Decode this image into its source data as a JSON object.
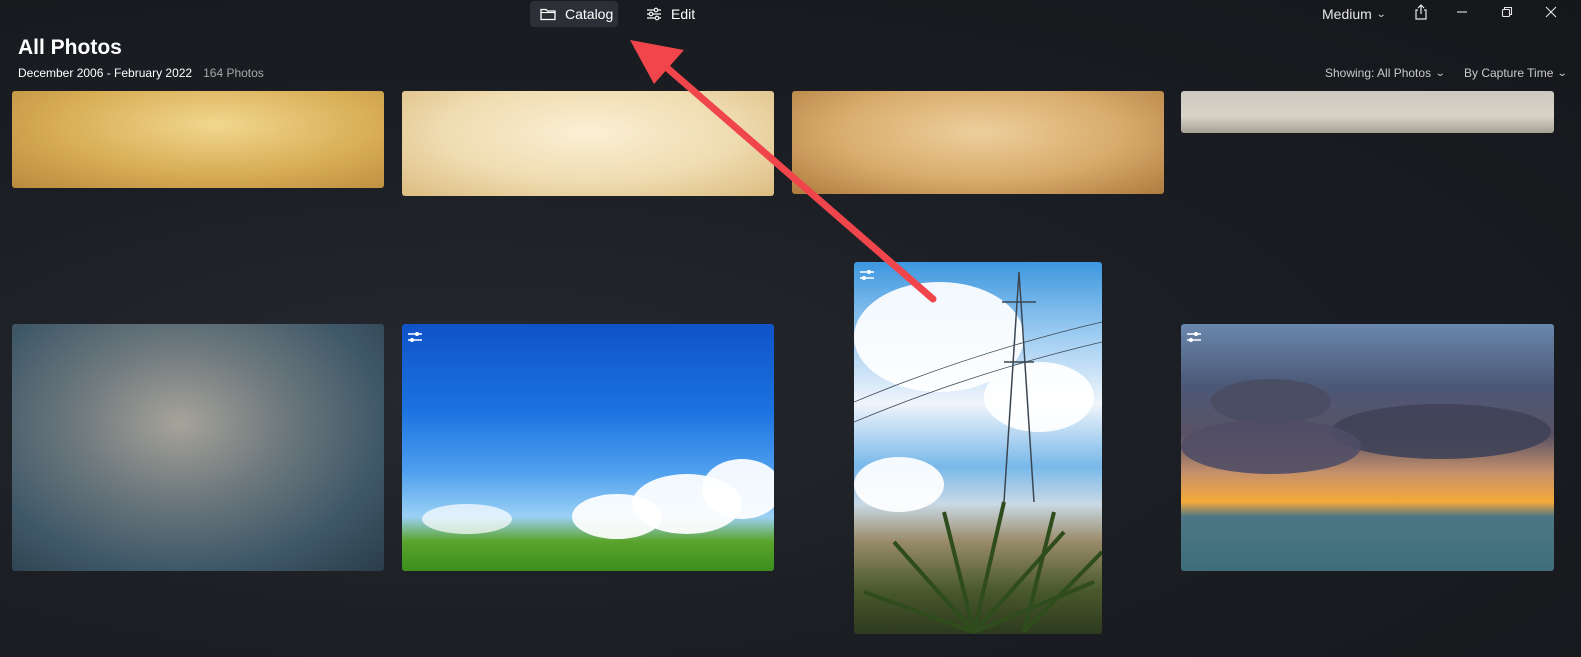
{
  "tabs": [
    {
      "label": "Catalog",
      "icon": "folder-icon",
      "active": true
    },
    {
      "label": "Edit",
      "icon": "sliders-icon",
      "active": false
    }
  ],
  "toolbar": {
    "size_label": "Medium"
  },
  "page": {
    "title": "All Photos",
    "date_range": "December 2006 - February 2022",
    "photo_count": "164 Photos"
  },
  "filters": {
    "showing": "Showing: All Photos",
    "sort": "By Capture Time"
  },
  "photos": [
    {
      "subject": "yellow parchment texture",
      "edited": false
    },
    {
      "subject": "cream parchment texture",
      "edited": false
    },
    {
      "subject": "tan parchment texture",
      "edited": false
    },
    {
      "subject": "grey concrete texture",
      "edited": false
    },
    {
      "subject": "dark blue grunge texture",
      "edited": false
    },
    {
      "subject": "blue sky over green field",
      "edited": true
    },
    {
      "subject": "power pylon and palm tree double exposure",
      "edited": true
    },
    {
      "subject": "sunset clouds over sea",
      "edited": true
    }
  ],
  "colors": {
    "accent_arrow": "#f0464b",
    "background": "#1b1e23"
  }
}
